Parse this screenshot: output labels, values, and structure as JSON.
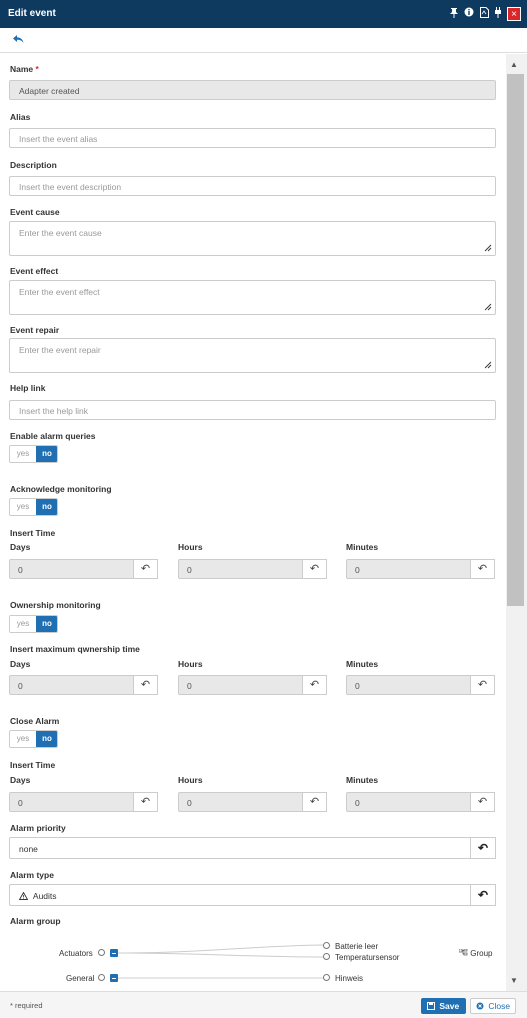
{
  "window": {
    "title": "Edit event",
    "icons": [
      "pin-icon",
      "info-icon",
      "pdf-icon",
      "plug-icon",
      "close-icon"
    ]
  },
  "back_icon": "undo-icon",
  "fields": {
    "name": {
      "label": "Name",
      "required_mark": "*",
      "value": "Adapter created"
    },
    "alias": {
      "label": "Alias",
      "placeholder": "Insert the event alias"
    },
    "description": {
      "label": "Description",
      "placeholder": "Insert the event description"
    },
    "cause": {
      "label": "Event cause",
      "placeholder": "Enter the event cause"
    },
    "effect": {
      "label": "Event effect",
      "placeholder": "Enter the event effect"
    },
    "repair": {
      "label": "Event repair",
      "placeholder": "Enter the event repair"
    },
    "help": {
      "label": "Help link",
      "placeholder": "Insert the help link"
    }
  },
  "toggle": {
    "yes": "yes",
    "no": "no"
  },
  "units": {
    "days": "Days",
    "hours": "Hours",
    "minutes": "Minutes"
  },
  "alarm_queries": {
    "label": "Enable alarm queries",
    "value": "no"
  },
  "acknowledge": {
    "label": "Acknowledge monitoring",
    "value": "no",
    "time_label": "Insert Time",
    "days": "0",
    "hours": "0",
    "minutes": "0"
  },
  "ownership": {
    "label": "Ownership monitoring",
    "value": "no",
    "time_label": "Insert maximum qwnership time",
    "days": "0",
    "hours": "0",
    "minutes": "0"
  },
  "close_alarm": {
    "label": "Close Alarm",
    "value": "no",
    "time_label": "Insert Time",
    "days": "0",
    "hours": "0",
    "minutes": "0"
  },
  "priority": {
    "label": "Alarm priority",
    "value": "none"
  },
  "alarm_type": {
    "label": "Alarm type",
    "value": "Audits",
    "icon": "warning-icon"
  },
  "alarm_group": {
    "label": "Alarm group",
    "groups": [
      {
        "name": "Actuators",
        "children": [
          "Batterie leer",
          "Temperatursensor"
        ]
      },
      {
        "name": "General",
        "children": [
          "Hinweis"
        ]
      }
    ],
    "group_button": "Group"
  },
  "footer": {
    "required_note": "* required",
    "save": "Save",
    "close": "Close"
  },
  "colors": {
    "titlebar": "#0f3a5f",
    "accent": "#1f6fb2",
    "close": "#d9262b"
  }
}
